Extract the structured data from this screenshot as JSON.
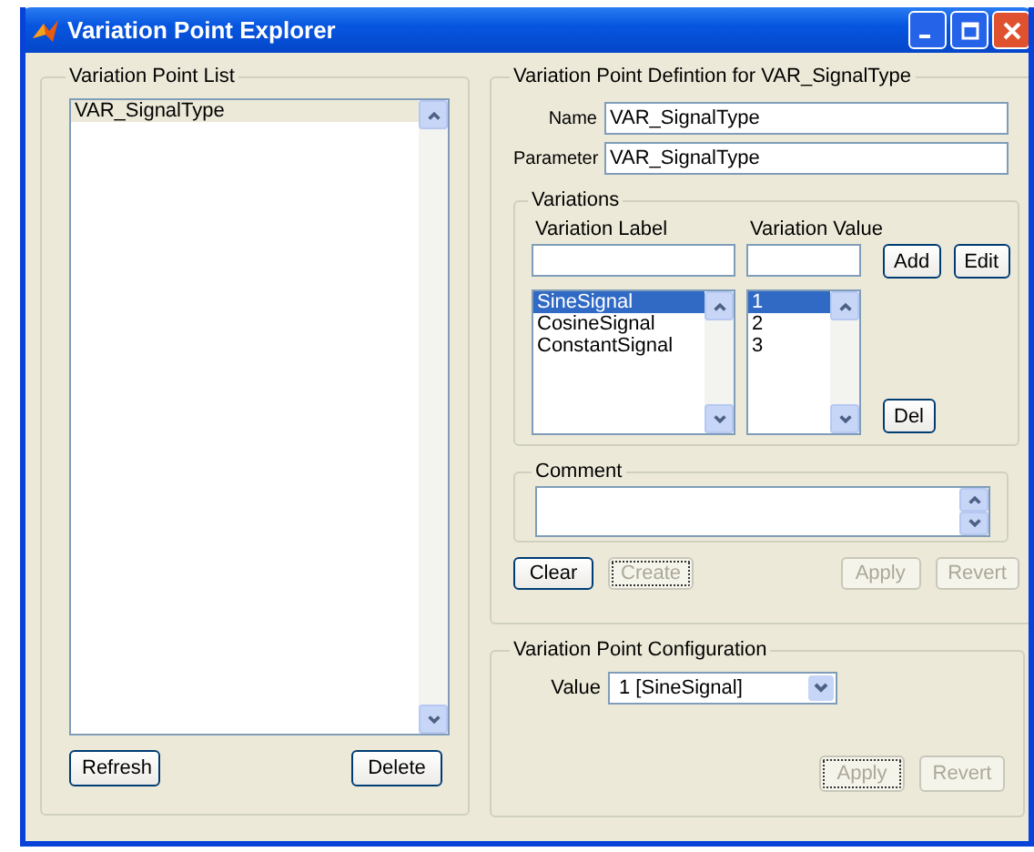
{
  "window": {
    "title": "Variation Point Explorer"
  },
  "point_list": {
    "title": "Variation Point List",
    "items": [
      {
        "label": "VAR_SignalType",
        "selected": true
      }
    ],
    "buttons": [
      {
        "label": "Refresh",
        "disabled": false,
        "focused": false
      },
      {
        "label": "Delete",
        "disabled": false,
        "focused": false
      }
    ]
  },
  "definition": {
    "title": "Variation Point Defintion for VAR_SignalType",
    "fields": [
      {
        "label": "Name",
        "value": "VAR_SignalType"
      },
      {
        "label": "Parameter",
        "value": "VAR_SignalType"
      }
    ],
    "variations": {
      "title": "Variations",
      "label_header": "Variation Label",
      "value_header": "Variation Value",
      "labels": [
        {
          "label": "SineSignal",
          "selected": true
        },
        {
          "label": "CosineSignal",
          "selected": false
        },
        {
          "label": "ConstantSignal",
          "selected": false
        }
      ],
      "values": [
        {
          "label": "1",
          "selected": true
        },
        {
          "label": "2",
          "selected": false
        },
        {
          "label": "3",
          "selected": false
        }
      ],
      "add": "Add",
      "edit": "Edit",
      "del": "Del"
    },
    "comment": {
      "title": "Comment"
    },
    "buttons": [
      {
        "label": "Clear",
        "disabled": false,
        "focused": false
      },
      {
        "label": "Create",
        "disabled": true,
        "focused": true
      },
      {
        "label": "Apply",
        "disabled": true,
        "focused": false
      },
      {
        "label": "Revert",
        "disabled": true,
        "focused": false
      }
    ]
  },
  "configuration": {
    "title": "Variation Point Configuration",
    "value_label": "Value",
    "value": "1 [SineSignal]",
    "buttons": [
      {
        "label": "Apply",
        "disabled": true,
        "focused": true
      },
      {
        "label": "Revert",
        "disabled": true,
        "focused": false
      }
    ]
  }
}
